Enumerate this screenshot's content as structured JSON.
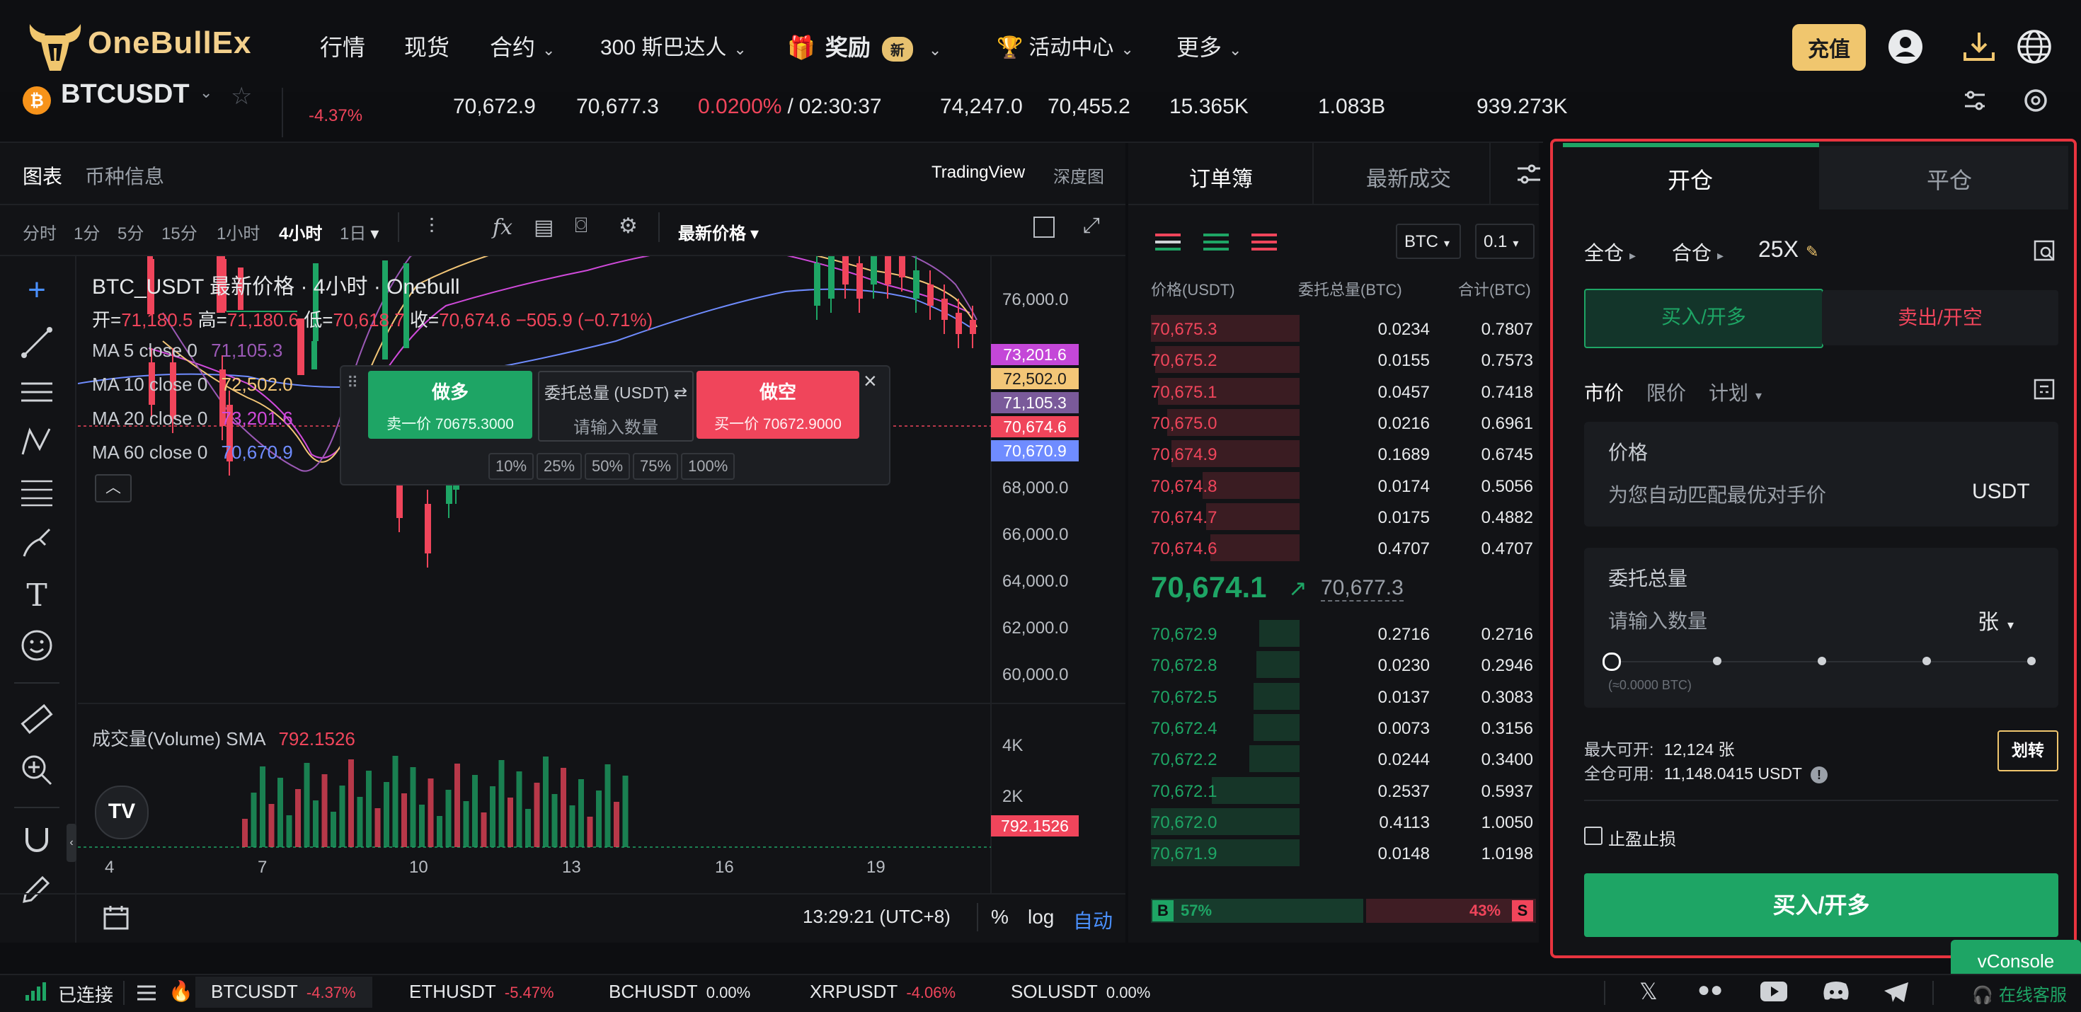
{
  "nav": {
    "brand": "OneBullEx",
    "items": [
      "行情",
      "现货",
      "合约",
      "300 斯巴达人",
      "奖励",
      "活动中心",
      "更多"
    ],
    "reward_badge": "新",
    "deposit": "充值",
    "icons": [
      "user-icon",
      "download-icon",
      "globe-icon"
    ]
  },
  "ticker": {
    "symbol": "BTCUSDT",
    "change": "-4.37%",
    "mark_price": "70,672.9",
    "index_price": "70,677.3",
    "funding_rate": "0.0200%",
    "funding_sep": "/",
    "countdown": "02:30:37",
    "high": "74,247.0",
    "low": "70,455.2",
    "volume": "15.365K",
    "turnover": "1.083B",
    "open_interest": "939.273K"
  },
  "chart": {
    "tabs": [
      "图表",
      "币种信息"
    ],
    "view_tabs": [
      "TradingView",
      "深度图"
    ],
    "intervals": [
      "分时",
      "1分",
      "5分",
      "15分",
      "1小时",
      "4小时",
      "1日"
    ],
    "active_interval": "4小时",
    "price_type": "最新价格",
    "title": "BTC_USDT 最新价格 · 4小时 · Onebull",
    "ohlc": {
      "open_label": "开=",
      "open": "71,180.5",
      "high_label": "高=",
      "high": "71,180.6",
      "low_label": "低=",
      "low": "70,618.7",
      "close_label": "收=",
      "close": "70,674.6",
      "change": "−505.9 (−0.71%)"
    },
    "ma": [
      {
        "label": "MA 5 close 0",
        "value": "71,105.3",
        "color": "#9b59b6"
      },
      {
        "label": "MA 10 close 0",
        "value": "72,502.0",
        "color": "#f3c677"
      },
      {
        "label": "MA 20 close 0",
        "value": "73,201.6",
        "color": "#d04adb"
      },
      {
        "label": "MA 60 close 0",
        "value": "70,670.9",
        "color": "#6f8cff"
      }
    ],
    "price_axis": [
      "76,000.0",
      "68,000.0",
      "66,000.0",
      "64,000.0",
      "62,000.0",
      "60,000.0"
    ],
    "price_tags": [
      {
        "value": "73,201.6",
        "color": "#c447d8"
      },
      {
        "value": "72,502.0",
        "color": "#f3c677"
      },
      {
        "value": "71,105.3",
        "color": "#7a5a9a"
      },
      {
        "value": "70,674.6",
        "color": "#f0455b"
      },
      {
        "value": "70,670.9",
        "color": "#6f8cff"
      }
    ],
    "volume_label": "成交量(Volume)",
    "volume_sma_label": "SMA",
    "volume_sma": "792.1526",
    "volume_axis": [
      "4K",
      "2K"
    ],
    "date_axis": [
      "4",
      "7",
      "10",
      "13",
      "16",
      "19"
    ],
    "clock": "13:29:21 (UTC+8)",
    "footer_btns": [
      "%",
      "log",
      "自动"
    ]
  },
  "quick_order": {
    "long_label": "做多",
    "long_sub": "卖一价 70675.3000",
    "short_label": "做空",
    "short_sub": "买一价 70672.9000",
    "qty_label": "委托总量 (USDT)",
    "qty_swap": "⇄",
    "qty_placeholder": "请输入数量",
    "pcts": [
      "10%",
      "25%",
      "50%",
      "75%",
      "100%"
    ]
  },
  "orderbook": {
    "tabs": [
      "订单簿",
      "最新成交"
    ],
    "coin": "BTC",
    "precision": "0.1",
    "headers": [
      "价格(USDT)",
      "委托总量(BTC)",
      "合计(BTC)"
    ],
    "asks": [
      {
        "price": "70,675.3",
        "qty": "0.0234",
        "total": "0.7807",
        "depth": 1.0
      },
      {
        "price": "70,675.2",
        "qty": "0.0155",
        "total": "0.7573",
        "depth": 0.97
      },
      {
        "price": "70,675.1",
        "qty": "0.0457",
        "total": "0.7418",
        "depth": 0.95
      },
      {
        "price": "70,675.0",
        "qty": "0.0216",
        "total": "0.6961",
        "depth": 0.89
      },
      {
        "price": "70,674.9",
        "qty": "0.1689",
        "total": "0.6745",
        "depth": 0.86
      },
      {
        "price": "70,674.8",
        "qty": "0.0174",
        "total": "0.5056",
        "depth": 0.65
      },
      {
        "price": "70,674.7",
        "qty": "0.0175",
        "total": "0.4882",
        "depth": 0.63
      },
      {
        "price": "70,674.6",
        "qty": "0.4707",
        "total": "0.4707",
        "depth": 0.6
      }
    ],
    "last_price": "70,674.1",
    "mark_price": "70,677.3",
    "bids": [
      {
        "price": "70,672.9",
        "qty": "0.2716",
        "total": "0.2716",
        "depth": 0.27
      },
      {
        "price": "70,672.8",
        "qty": "0.0230",
        "total": "0.2946",
        "depth": 0.29
      },
      {
        "price": "70,672.5",
        "qty": "0.0137",
        "total": "0.3083",
        "depth": 0.31
      },
      {
        "price": "70,672.4",
        "qty": "0.0073",
        "total": "0.3156",
        "depth": 0.31
      },
      {
        "price": "70,672.2",
        "qty": "0.0244",
        "total": "0.3400",
        "depth": 0.34
      },
      {
        "price": "70,672.1",
        "qty": "0.2537",
        "total": "0.5937",
        "depth": 0.59
      },
      {
        "price": "70,672.0",
        "qty": "0.4113",
        "total": "1.0050",
        "depth": 1.0
      },
      {
        "price": "70,671.9",
        "qty": "0.0148",
        "total": "1.0198",
        "depth": 1.0
      }
    ],
    "buy_ratio": "57%",
    "sell_ratio": "43%",
    "buy_letter": "B",
    "sell_letter": "S"
  },
  "trade": {
    "tabs": [
      "开仓",
      "平仓"
    ],
    "margin_mode": "全仓",
    "position_mode": "合仓",
    "leverage": "25X",
    "sides": [
      "买入/开多",
      "卖出/开空"
    ],
    "order_types": [
      "市价",
      "限价",
      "计划"
    ],
    "price_label": "价格",
    "price_placeholder": "为您自动匹配最优对手价",
    "price_unit": "USDT",
    "qty_label": "委托总量",
    "qty_placeholder": "请输入数量",
    "qty_unit": "张",
    "slider_hint": "(≈0.0000 BTC)",
    "max_open_label": "最大可开:",
    "max_open": "12,124 张",
    "available_label": "全仓可用:",
    "available": "11,148.0415 USDT",
    "transfer": "划转",
    "tpsl": "止盈止损",
    "submit": "买入/开多",
    "vconsole": "vConsole"
  },
  "status": {
    "connected": "已连接",
    "pairs": [
      {
        "symbol": "BTCUSDT",
        "change": "-4.37%",
        "dir": "neg"
      },
      {
        "symbol": "ETHUSDT",
        "change": "-5.47%",
        "dir": "neg"
      },
      {
        "symbol": "BCHUSDT",
        "change": "0.00%",
        "dir": "flat"
      },
      {
        "symbol": "XRPUSDT",
        "change": "-4.06%",
        "dir": "neg"
      },
      {
        "symbol": "SOLUSDT",
        "change": "0.00%",
        "dir": "flat"
      }
    ],
    "support": "在线客服"
  }
}
